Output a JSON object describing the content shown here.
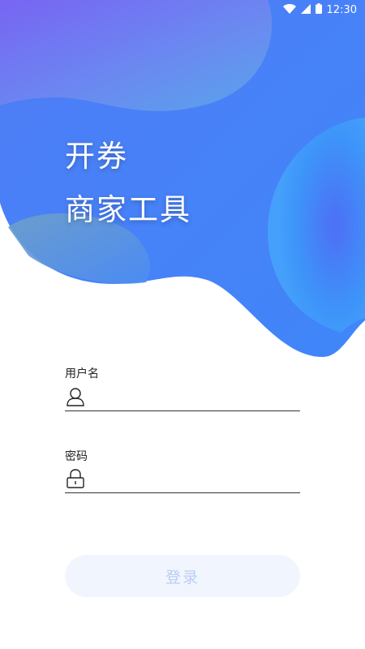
{
  "status_bar": {
    "time": "12:30",
    "icons": [
      "wifi-icon",
      "signal-icon",
      "battery-icon"
    ]
  },
  "hero": {
    "title_line1": "开券",
    "title_line2": "商家工具"
  },
  "form": {
    "username": {
      "label": "用户名",
      "value": "",
      "icon": "user-icon"
    },
    "password": {
      "label": "密码",
      "value": "",
      "icon": "lock-icon"
    }
  },
  "login_button": {
    "label": "登录"
  },
  "colors": {
    "hero_blue": "#4a86f7",
    "button_bg": "#f1f5fe",
    "button_text": "#b9cdf3"
  }
}
